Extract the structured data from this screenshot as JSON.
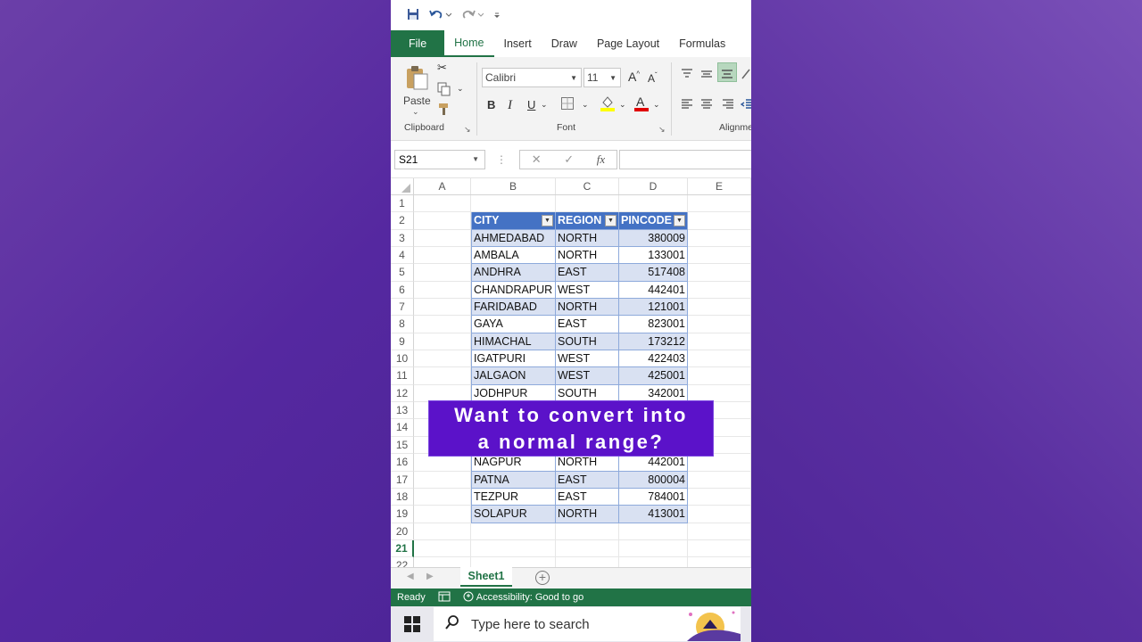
{
  "ribbon_tabs": [
    "File",
    "Home",
    "Insert",
    "Draw",
    "Page Layout",
    "Formulas"
  ],
  "clipboard": {
    "paste_label": "Paste",
    "group_label": "Clipboard"
  },
  "font": {
    "name": "Calibri",
    "size": "11",
    "group_label": "Font",
    "bold": "B",
    "italic": "I",
    "underline": "U"
  },
  "alignment": {
    "group_label": "Alignme"
  },
  "formula_bar": {
    "name_box": "S21",
    "fx": "fx"
  },
  "columns": [
    "A",
    "B",
    "C",
    "D",
    "E"
  ],
  "table": {
    "headers": [
      "CITY",
      "REGION",
      "PINCODE"
    ],
    "rows": [
      [
        "AHMEDABAD",
        "NORTH",
        "380009"
      ],
      [
        "AMBALA",
        "NORTH",
        "133001"
      ],
      [
        "ANDHRA",
        "EAST",
        "517408"
      ],
      [
        "CHANDRAPUR",
        "WEST",
        "442401"
      ],
      [
        "FARIDABAD",
        "NORTH",
        "121001"
      ],
      [
        "GAYA",
        "EAST",
        "823001"
      ],
      [
        "HIMACHAL",
        "SOUTH",
        "173212"
      ],
      [
        "IGATPURI",
        "WEST",
        "422403"
      ],
      [
        "JALGAON",
        "WEST",
        "425001"
      ],
      [
        "JODHPUR",
        "SOUTH",
        "342001"
      ],
      [
        "",
        "",
        ""
      ],
      [
        "",
        "",
        ""
      ],
      [
        "",
        "",
        ""
      ],
      [
        "NAGPUR",
        "NORTH",
        "442001"
      ],
      [
        "PATNA",
        "EAST",
        "800004"
      ],
      [
        "TEZPUR",
        "EAST",
        "784001"
      ],
      [
        "SOLAPUR",
        "NORTH",
        "413001"
      ]
    ]
  },
  "row_numbers": [
    "1",
    "2",
    "3",
    "4",
    "5",
    "6",
    "7",
    "8",
    "9",
    "10",
    "11",
    "12",
    "13",
    "14",
    "15",
    "16",
    "17",
    "18",
    "19",
    "20",
    "21",
    "22"
  ],
  "overlay": {
    "line1": "Want to convert into",
    "line2": "a normal range?"
  },
  "sheet": {
    "tab": "Sheet1"
  },
  "status": {
    "ready": "Ready",
    "accessibility": "Accessibility: Good to go"
  },
  "taskbar": {
    "search_placeholder": "Type here to search"
  },
  "colors": {
    "excel_green": "#217346",
    "table_header": "#4472c4",
    "band": "#d9e1f2",
    "overlay": "#5b12c9"
  }
}
